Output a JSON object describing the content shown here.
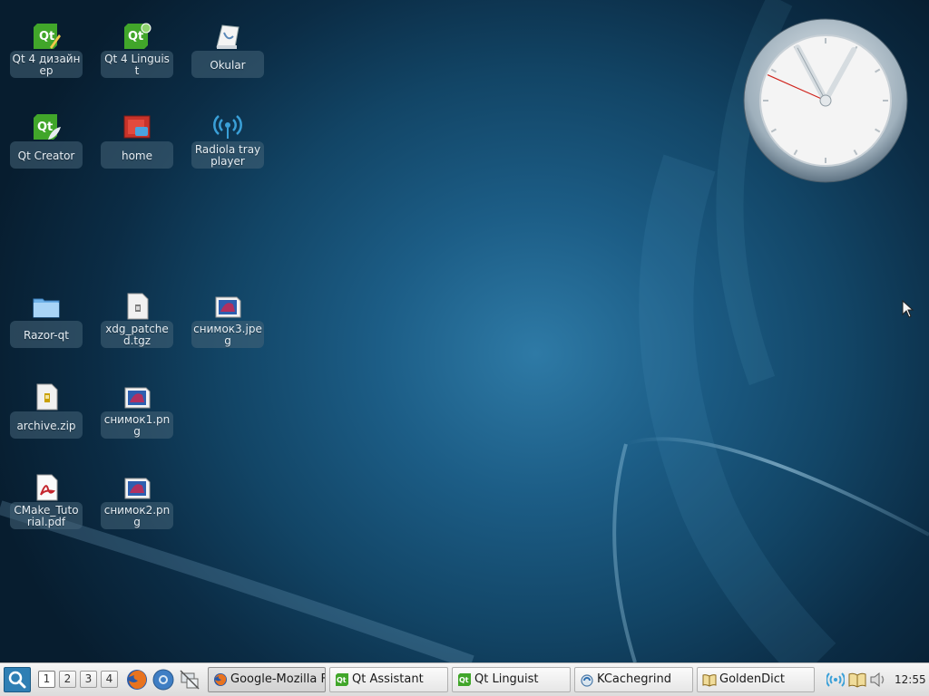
{
  "desktop": {
    "icons": [
      {
        "label": "Qt 4 дизайнер",
        "icon": "qt-designer-icon"
      },
      {
        "label": "Qt 4 Linguist",
        "icon": "qt-linguist-icon"
      },
      {
        "label": "Okular",
        "icon": "okular-icon"
      },
      {
        "label": "Qt Creator",
        "icon": "qt-creator-icon"
      },
      {
        "label": "home",
        "icon": "home-folder-icon"
      },
      {
        "label": "Radiola tray player",
        "icon": "radio-icon"
      },
      {
        "label": "Razor-qt",
        "icon": "folder-icon"
      },
      {
        "label": "xdg_patched.tgz",
        "icon": "archive-tgz-icon"
      },
      {
        "label": "снимок3.jpeg",
        "icon": "image-file-icon"
      },
      {
        "label": "archive.zip",
        "icon": "archive-zip-icon"
      },
      {
        "label": "снимок1.png",
        "icon": "image-file-icon"
      },
      {
        "label": "CMake_Tutorial.pdf",
        "icon": "pdf-file-icon"
      },
      {
        "label": "снимок2.png",
        "icon": "image-file-icon"
      }
    ]
  },
  "clock_widget": {
    "hours": 11,
    "minutes": 4,
    "seconds": 49
  },
  "taskbar": {
    "menu_icon": "search-icon",
    "workspaces": [
      "1",
      "2",
      "3",
      "4"
    ],
    "active_workspace": 0,
    "quicklaunch": [
      "firefox-icon",
      "chromium-icon",
      "network-icon"
    ],
    "tasks": [
      {
        "label": "Google-Mozilla Fi",
        "icon": "firefox-icon"
      },
      {
        "label": "Qt Assistant",
        "icon": "qt-icon"
      },
      {
        "label": "Qt Linguist",
        "icon": "qt-linguist-icon"
      },
      {
        "label": "KCachegrind",
        "icon": "kcachegrind-icon"
      },
      {
        "label": "GoldenDict",
        "icon": "dictionary-icon"
      }
    ],
    "tray": [
      "wifi-icon",
      "dictionary-icon",
      "volume-icon"
    ],
    "clock": "12:55"
  },
  "colors": {
    "accent": "#2f7fb4",
    "qt_green": "#41a62a"
  }
}
